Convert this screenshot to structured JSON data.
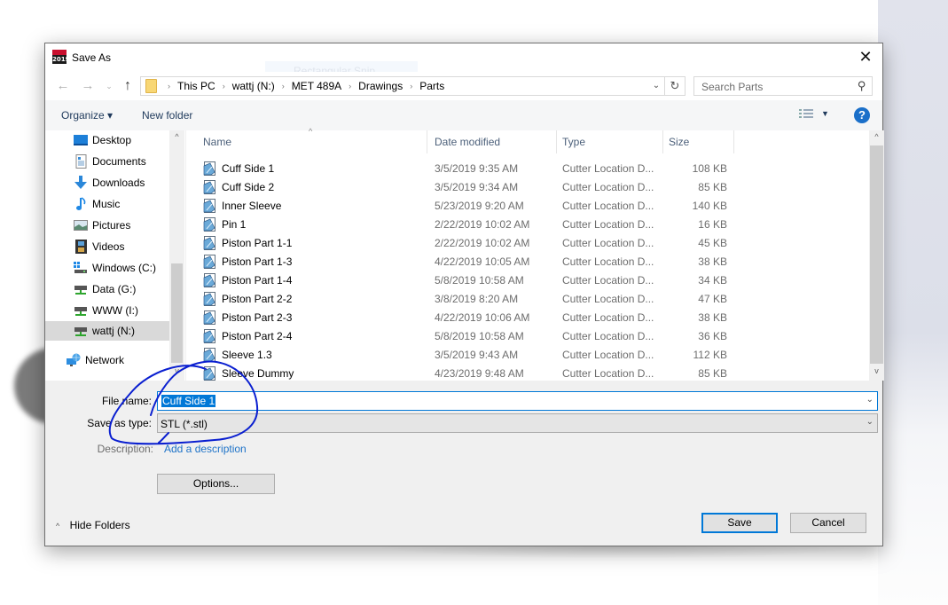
{
  "background": {
    "ghost_overlay_text": "Rectangular Snip"
  },
  "dialog": {
    "title": "Save As",
    "app_icon_text": "2019",
    "close_glyph": "✕"
  },
  "navigation": {
    "back_glyph": "←",
    "forward_glyph": "→",
    "recent_glyph": "⌄",
    "up_glyph": "↑",
    "breadcrumbs": [
      "This PC",
      "wattj (N:)",
      "MET 489A",
      "Drawings",
      "Parts"
    ],
    "crumb_separator": "›",
    "address_dropdown_glyph": "⌄",
    "refresh_glyph": "↻",
    "search_placeholder": "Search Parts",
    "search_glyph": "⚲"
  },
  "toolbar": {
    "organize_label": "Organize ▾",
    "new_folder_label": "New folder",
    "view_dropdown_glyph": "▼",
    "help_glyph": "?"
  },
  "sidebar": {
    "items": [
      {
        "label": "Desktop",
        "icon": "desktop-icon",
        "selected": false
      },
      {
        "label": "Documents",
        "icon": "documents-icon",
        "selected": false
      },
      {
        "label": "Downloads",
        "icon": "downloads-icon",
        "selected": false
      },
      {
        "label": "Music",
        "icon": "music-icon",
        "selected": false
      },
      {
        "label": "Pictures",
        "icon": "pictures-icon",
        "selected": false
      },
      {
        "label": "Videos",
        "icon": "videos-icon",
        "selected": false
      },
      {
        "label": "Windows (C:)",
        "icon": "windows-drive-icon",
        "selected": false
      },
      {
        "label": "Data (G:)",
        "icon": "network-drive-icon",
        "selected": false
      },
      {
        "label": "WWW (I:)",
        "icon": "network-drive-icon",
        "selected": false
      },
      {
        "label": "wattj (N:)",
        "icon": "network-drive-icon",
        "selected": true
      },
      {
        "label": "Network",
        "icon": "network-icon",
        "selected": false
      }
    ],
    "scroll_up_glyph": "^",
    "scroll_down_glyph": "v"
  },
  "file_list": {
    "columns": [
      "Name",
      "Date modified",
      "Type",
      "Size"
    ],
    "sort_glyph": "^",
    "rows": [
      {
        "name": "Cuff Side 1",
        "date": "3/5/2019 9:35 AM",
        "type": "Cutter Location D...",
        "size": "108 KB"
      },
      {
        "name": "Cuff Side 2",
        "date": "3/5/2019 9:34 AM",
        "type": "Cutter Location D...",
        "size": "85 KB"
      },
      {
        "name": "Inner Sleeve",
        "date": "5/23/2019 9:20 AM",
        "type": "Cutter Location D...",
        "size": "140 KB"
      },
      {
        "name": "Pin 1",
        "date": "2/22/2019 10:02 AM",
        "type": "Cutter Location D...",
        "size": "16 KB"
      },
      {
        "name": "Piston Part 1-1",
        "date": "2/22/2019 10:02 AM",
        "type": "Cutter Location D...",
        "size": "45 KB"
      },
      {
        "name": "Piston Part 1-3",
        "date": "4/22/2019 10:05 AM",
        "type": "Cutter Location D...",
        "size": "38 KB"
      },
      {
        "name": "Piston Part 1-4",
        "date": "5/8/2019 10:58 AM",
        "type": "Cutter Location D...",
        "size": "34 KB"
      },
      {
        "name": "Piston Part 2-2",
        "date": "3/8/2019 8:20 AM",
        "type": "Cutter Location D...",
        "size": "47 KB"
      },
      {
        "name": "Piston Part 2-3",
        "date": "4/22/2019 10:06 AM",
        "type": "Cutter Location D...",
        "size": "38 KB"
      },
      {
        "name": "Piston Part 2-4",
        "date": "5/8/2019 10:58 AM",
        "type": "Cutter Location D...",
        "size": "36 KB"
      },
      {
        "name": "Sleeve 1.3",
        "date": "3/5/2019 9:43 AM",
        "type": "Cutter Location D...",
        "size": "112 KB"
      },
      {
        "name": "Sleeve Dummy",
        "date": "4/23/2019 9:48 AM",
        "type": "Cutter Location D...",
        "size": "85 KB"
      }
    ],
    "scroll_up_glyph": "^",
    "scroll_down_glyph": "v"
  },
  "form": {
    "file_name_label": "File name:",
    "file_name_value": "Cuff Side 1",
    "save_type_label": "Save as type:",
    "save_type_value": "STL (*.stl)",
    "description_label": "Description:",
    "description_link": "Add a description",
    "dropdown_glyph": "⌄",
    "options_label": "Options..."
  },
  "footer": {
    "hide_folders_glyph": "^",
    "hide_folders_label": "Hide Folders",
    "save_label": "Save",
    "cancel_label": "Cancel"
  },
  "annotation": {
    "color": "#0a1fd0"
  }
}
